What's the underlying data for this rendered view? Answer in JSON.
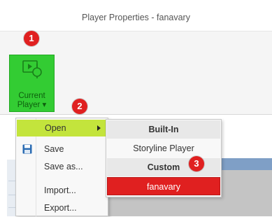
{
  "window": {
    "title": "Player Properties - fanavary"
  },
  "ribbon": {
    "player_button": {
      "line1": "Current",
      "line2": "Player ▾",
      "icon": "player-icon"
    }
  },
  "callouts": [
    "1",
    "2",
    "3"
  ],
  "menu": {
    "items": [
      {
        "label": "Open",
        "icon": "",
        "has_submenu": true
      },
      {
        "label": "Save",
        "icon": "save-icon"
      },
      {
        "label": "Save as...",
        "icon": ""
      },
      {
        "label": "Import...",
        "icon": ""
      },
      {
        "label": "Export...",
        "icon": ""
      }
    ]
  },
  "submenu": {
    "builtin_header": "Built-In",
    "builtin_item": "Storyline Player",
    "custom_header": "Custom",
    "custom_item": "fanavary"
  },
  "colors": {
    "highlight_green": "#33cc33",
    "menu_active": "#c3e43c",
    "callout_red": "#e02020",
    "selected_red": "#e02020"
  }
}
